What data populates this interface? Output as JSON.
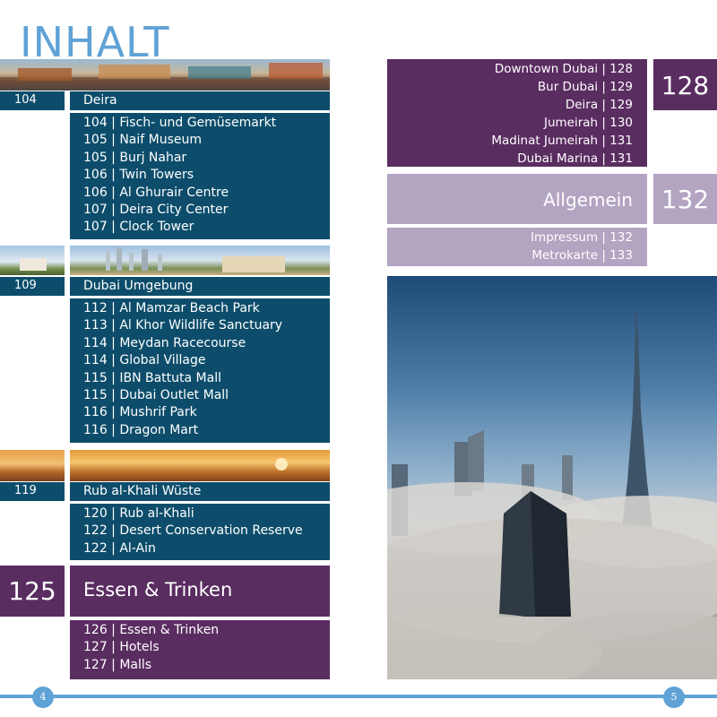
{
  "title": "INHALT",
  "left": {
    "deira": {
      "num": "104",
      "label": "Deira",
      "items": [
        "104 | Fisch- und Gemüsemarkt",
        "105 | Naif Museum",
        "105 | Burj Nahar",
        "106 | Twin Towers",
        "106 | Al Ghurair Centre",
        "107 | Deira City Center",
        "107 | Clock Tower"
      ]
    },
    "umgebung": {
      "num": "109",
      "label": "Dubai Umgebung",
      "items": [
        "112 | Al Mamzar Beach Park",
        "113 | Al Khor Wildlife Sanctuary",
        "114 | Meydan Racecourse",
        "114 | Global Village",
        "115 | IBN Battuta Mall",
        "115 | Dubai Outlet Mall",
        "116 | Mushrif Park",
        "116 | Dragon Mart"
      ]
    },
    "rub": {
      "num": "119",
      "label": "Rub al-Khali Wüste",
      "items": [
        "120 | Rub al-Khali",
        "122 | Desert Conservation Reserve",
        "122 | Al-Ain"
      ]
    },
    "essen": {
      "num": "125",
      "label": "Essen & Trinken",
      "items": [
        "126 | Essen & Trinken",
        "127 | Hotels",
        "127 | Malls"
      ]
    }
  },
  "right": {
    "hotels": {
      "num": "128",
      "items": [
        "Downtown Dubai | 128",
        "Bur Dubai | 129",
        "Deira | 129",
        "Jumeirah | 130",
        "Madinat Jumeirah | 131",
        "Dubai Marina | 131"
      ]
    },
    "allgemein": {
      "num": "132",
      "label": "Allgemein",
      "items": [
        "Impressum | 132",
        "Metrokarte | 133"
      ]
    }
  },
  "footer": {
    "left_page": "4",
    "right_page": "5"
  }
}
